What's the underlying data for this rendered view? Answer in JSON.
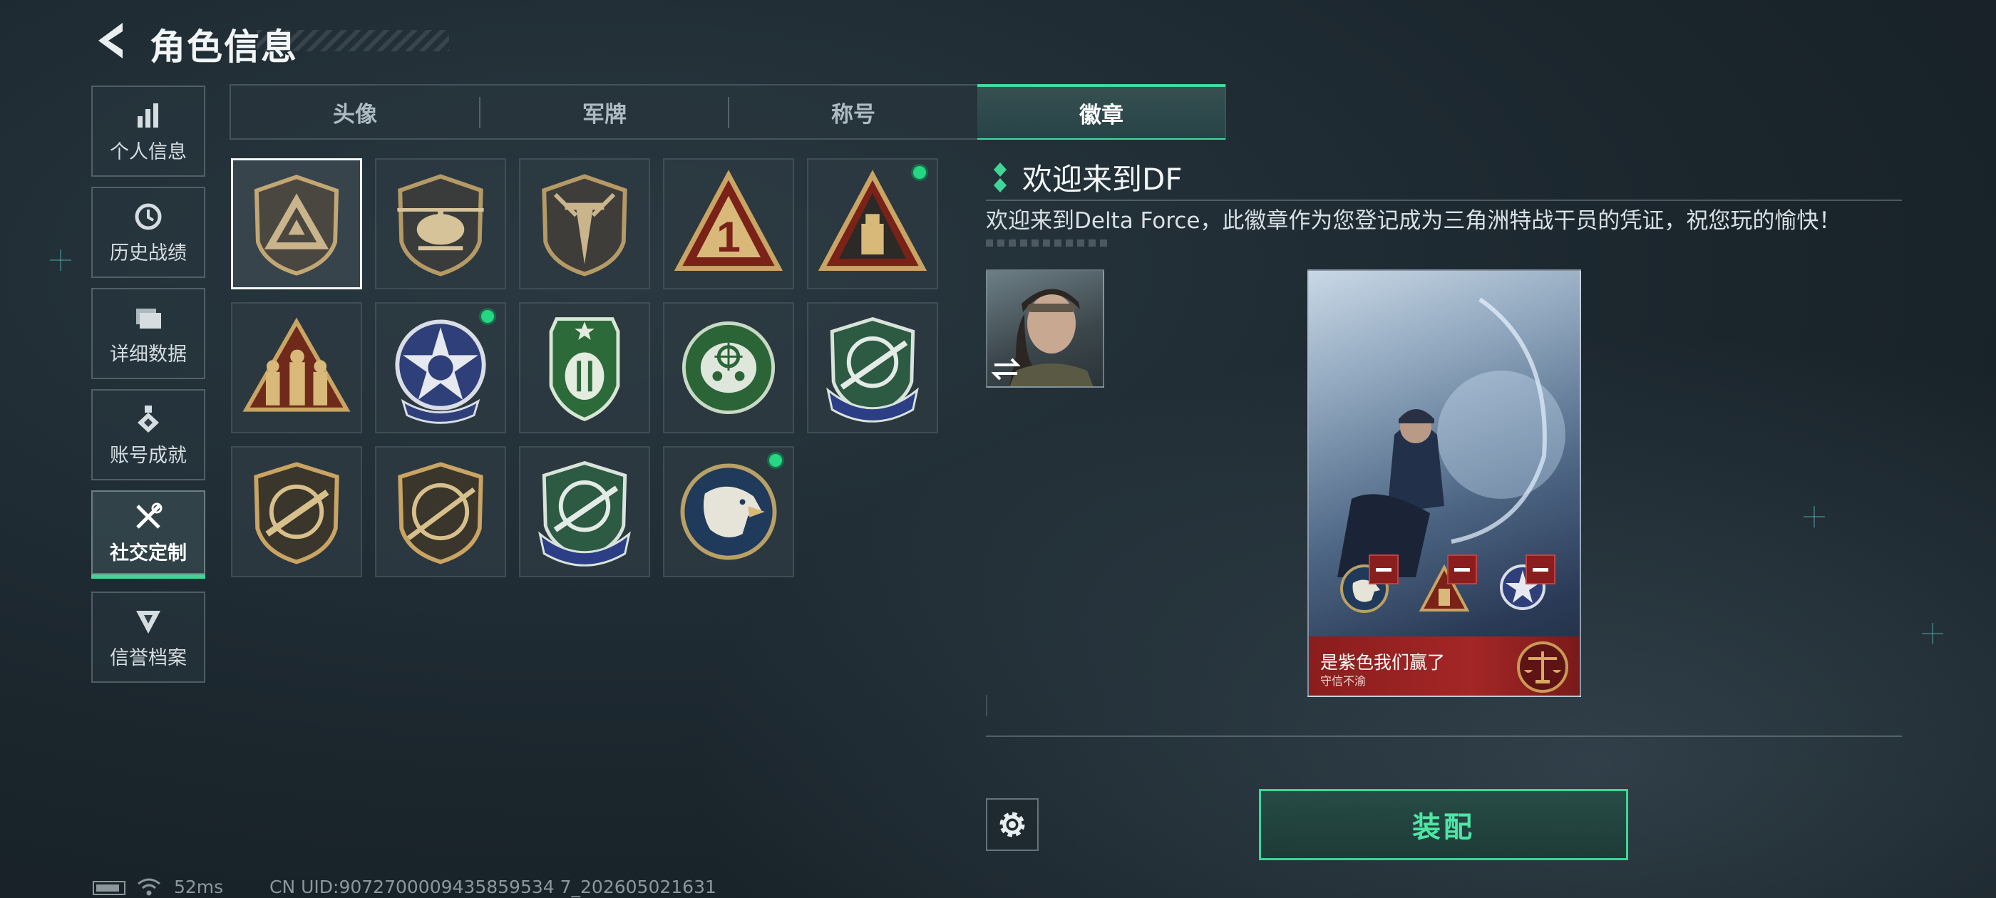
{
  "header": {
    "title": "角色信息"
  },
  "nav": {
    "items": [
      {
        "label": "个人信息",
        "icon": "bar-chart-icon"
      },
      {
        "label": "历史战绩",
        "icon": "history-clock-icon"
      },
      {
        "label": "详细数据",
        "icon": "folder-icon"
      },
      {
        "label": "账号成就",
        "icon": "achievement-medal-icon"
      },
      {
        "label": "社交定制",
        "icon": "tools-wrench-icon",
        "active": true
      },
      {
        "label": "信誉档案",
        "icon": "shield-rank-icon"
      }
    ]
  },
  "tabs": [
    {
      "label": "头像"
    },
    {
      "label": "军牌"
    },
    {
      "label": "称号"
    },
    {
      "label": "徽章",
      "active": true
    }
  ],
  "badges": [
    {
      "name": "delta-triangle-badge",
      "new": false,
      "selected": true
    },
    {
      "name": "helicopter-badge",
      "new": false
    },
    {
      "name": "dagger-shield-badge",
      "new": false
    },
    {
      "name": "number-one-triangle-badge",
      "new": false
    },
    {
      "name": "usb-triangle-badge",
      "new": true
    },
    {
      "name": "soldiers-triangle-badge",
      "new": false
    },
    {
      "name": "star-skull-badge",
      "new": true
    },
    {
      "name": "green-shield-emblem-badge",
      "new": false
    },
    {
      "name": "green-skull-crosshair-badge",
      "new": false
    },
    {
      "name": "rifle-crosshair-blue-badge",
      "new": false
    },
    {
      "name": "rifle-crosshair-gold-badge",
      "new": false
    },
    {
      "name": "sniper-crosshair-gold-badge",
      "new": false
    },
    {
      "name": "rifle-crosshair-blue-banner-badge",
      "new": false
    },
    {
      "name": "eagle-round-badge",
      "new": true
    }
  ],
  "detail": {
    "badge_name": "欢迎来到DF",
    "description": "欢迎来到Delta Force，此徽章作为您登记成为三角洲特战干员的凭证，祝您玩的愉快！"
  },
  "card": {
    "name": "是紫色我们赢了",
    "subtitle": "守信不渝"
  },
  "actions": {
    "equip_label": "装配"
  },
  "status": {
    "ping": "52ms",
    "uid": "CN UID:9072700009435859534 7_202605021631"
  },
  "colors": {
    "accent": "#3fd698",
    "new_dot": "#25d683",
    "card_red": "#a42626"
  }
}
